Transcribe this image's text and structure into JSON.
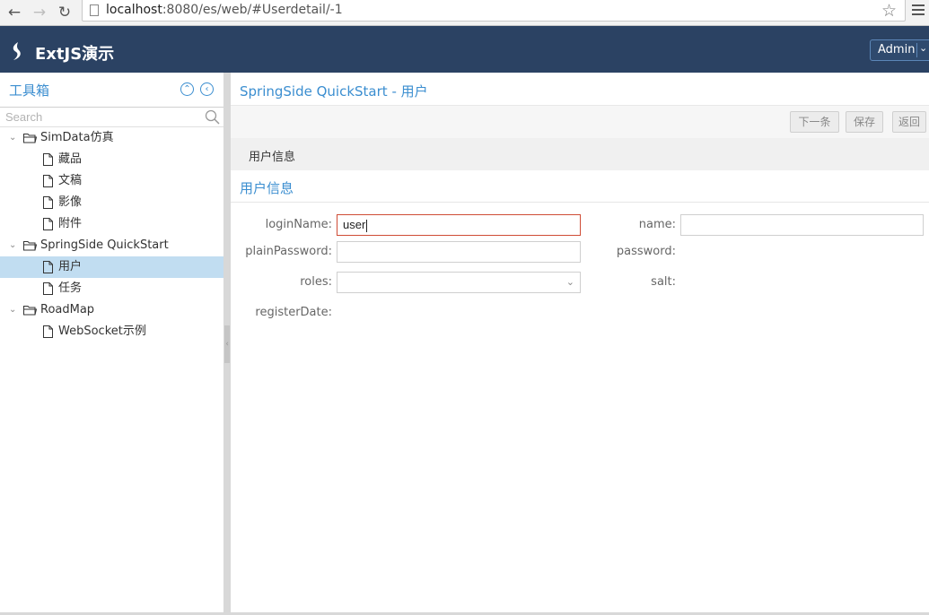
{
  "browser": {
    "back_glyph": "←",
    "forward_glyph": "→",
    "reload_glyph": "↻",
    "url_host": "localhost",
    "url_rest": ":8080/es/web/#Userdetail/-1",
    "star_glyph": "☆"
  },
  "header": {
    "title": "ExtJS演示",
    "user_button": "Admin",
    "user_arrow": "⌄"
  },
  "sidebar": {
    "title": "工具箱",
    "collapse_glyph": "⌃",
    "back_glyph": "‹",
    "search_placeholder": "Search",
    "tree": [
      {
        "label": "SimData仿真",
        "type": "folder",
        "level": 0
      },
      {
        "label": "藏品",
        "type": "leaf",
        "level": 1
      },
      {
        "label": "文稿",
        "type": "leaf",
        "level": 1
      },
      {
        "label": "影像",
        "type": "leaf",
        "level": 1
      },
      {
        "label": "附件",
        "type": "leaf",
        "level": 1
      },
      {
        "label": "SpringSide QuickStart",
        "type": "folder",
        "level": 0
      },
      {
        "label": "用户",
        "type": "leaf",
        "level": 1,
        "selected": true
      },
      {
        "label": "任务",
        "type": "leaf",
        "level": 1
      },
      {
        "label": "RoadMap",
        "type": "folder",
        "level": 0
      },
      {
        "label": "WebSocket示例",
        "type": "leaf",
        "level": 1
      }
    ]
  },
  "main": {
    "title": "SpringSide QuickStart - 用户",
    "toolbar": {
      "next_label": "下一条",
      "save_label": "保存",
      "back_label": "返回"
    },
    "tab_label": "用户信息",
    "section_title": "用户信息",
    "form": {
      "loginName_label": "loginName:",
      "loginName_value": "user",
      "name_label": "name:",
      "name_value": "",
      "plainPassword_label": "plainPassword:",
      "plainPassword_value": "",
      "password_label": "password:",
      "roles_label": "roles:",
      "roles_value": "",
      "salt_label": "salt:",
      "registerDate_label": "registerDate:"
    }
  },
  "colors": {
    "header_bg": "#2b4263",
    "accent": "#3b8ed0",
    "selected_row": "#c1ddf1",
    "invalid_border": "#cf4c35"
  }
}
